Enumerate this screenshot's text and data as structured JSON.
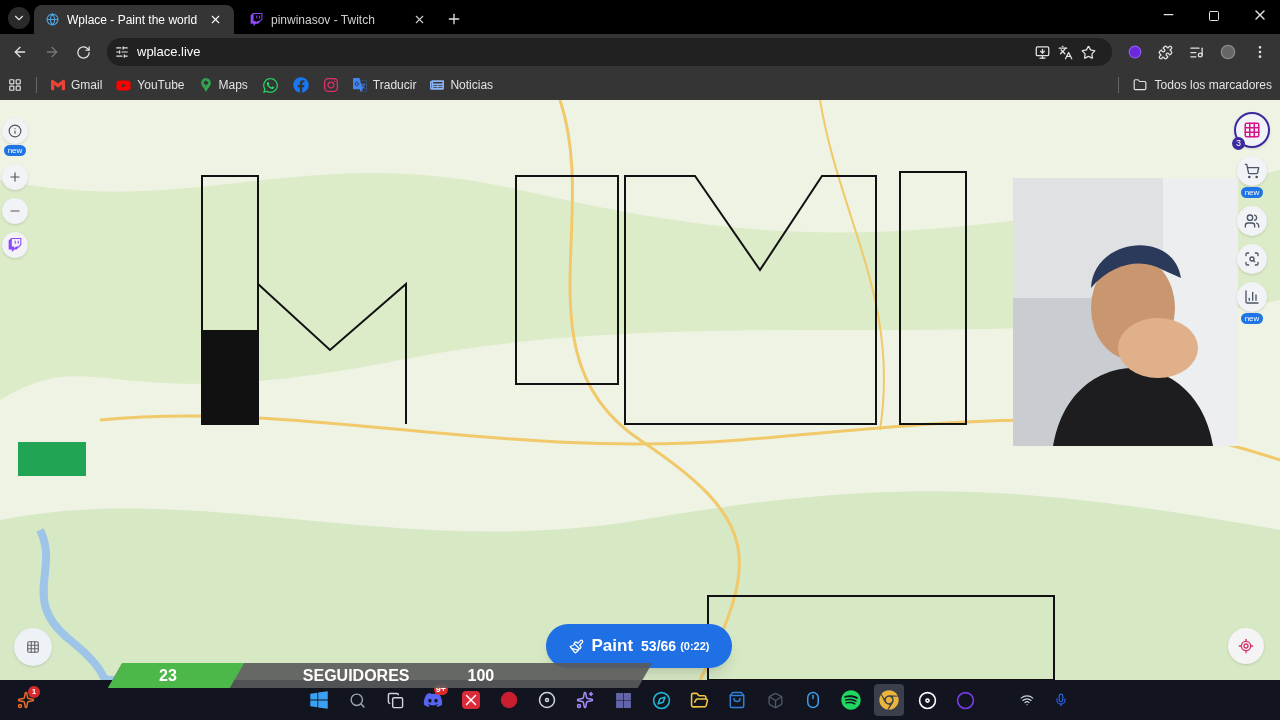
{
  "browser": {
    "tabs": [
      {
        "title": "Wplace - Paint the world",
        "selected": true,
        "kind": "globe"
      },
      {
        "title": "pinwinasov - Twitch",
        "selected": false,
        "kind": "twitch"
      }
    ],
    "url": "wplace.live",
    "bookmarks": [
      {
        "kind": "gmail",
        "label": "Gmail"
      },
      {
        "kind": "youtube",
        "label": "YouTube"
      },
      {
        "kind": "maps",
        "label": "Maps"
      },
      {
        "kind": "whatsapp"
      },
      {
        "kind": "facebook"
      },
      {
        "kind": "instagram"
      },
      {
        "kind": "translate",
        "label": "Traducir"
      },
      {
        "kind": "news",
        "label": "Noticias"
      }
    ],
    "all_bookmarks": "Todos los marcadores"
  },
  "wplace": {
    "left_controls": [
      {
        "kind": "info",
        "badge": "new"
      },
      {
        "kind": "zoom-in"
      },
      {
        "kind": "zoom-out"
      },
      {
        "kind": "twitch"
      }
    ],
    "right_controls": [
      {
        "kind": "account",
        "badge": "3"
      },
      {
        "kind": "store",
        "badge": "new"
      },
      {
        "kind": "alliance"
      },
      {
        "kind": "search"
      },
      {
        "kind": "leaderboard",
        "badge": "new"
      }
    ],
    "paint_button": {
      "label": "Paint",
      "count": "53/66",
      "timer": "(0:22)"
    }
  },
  "stream_overlay": {
    "followers": "23",
    "label": "SEGUIDORES",
    "goal": "100",
    "level": 0.23
  },
  "taskbar": {
    "apps": [
      {
        "kind": "windows"
      },
      {
        "kind": "search"
      },
      {
        "kind": "task-view"
      },
      {
        "kind": "discord",
        "badge": "9+"
      },
      {
        "kind": "x-app"
      },
      {
        "kind": "red-app"
      },
      {
        "kind": "disc"
      },
      {
        "kind": "copilot"
      },
      {
        "kind": "teams"
      },
      {
        "kind": "edge"
      },
      {
        "kind": "files"
      },
      {
        "kind": "store"
      },
      {
        "kind": "dropbox"
      },
      {
        "kind": "mouse"
      },
      {
        "kind": "spotify"
      },
      {
        "kind": "chrome",
        "selected": true
      },
      {
        "kind": "obs"
      },
      {
        "kind": "circle-app"
      }
    ],
    "corner_app": {
      "badge": "1"
    }
  }
}
